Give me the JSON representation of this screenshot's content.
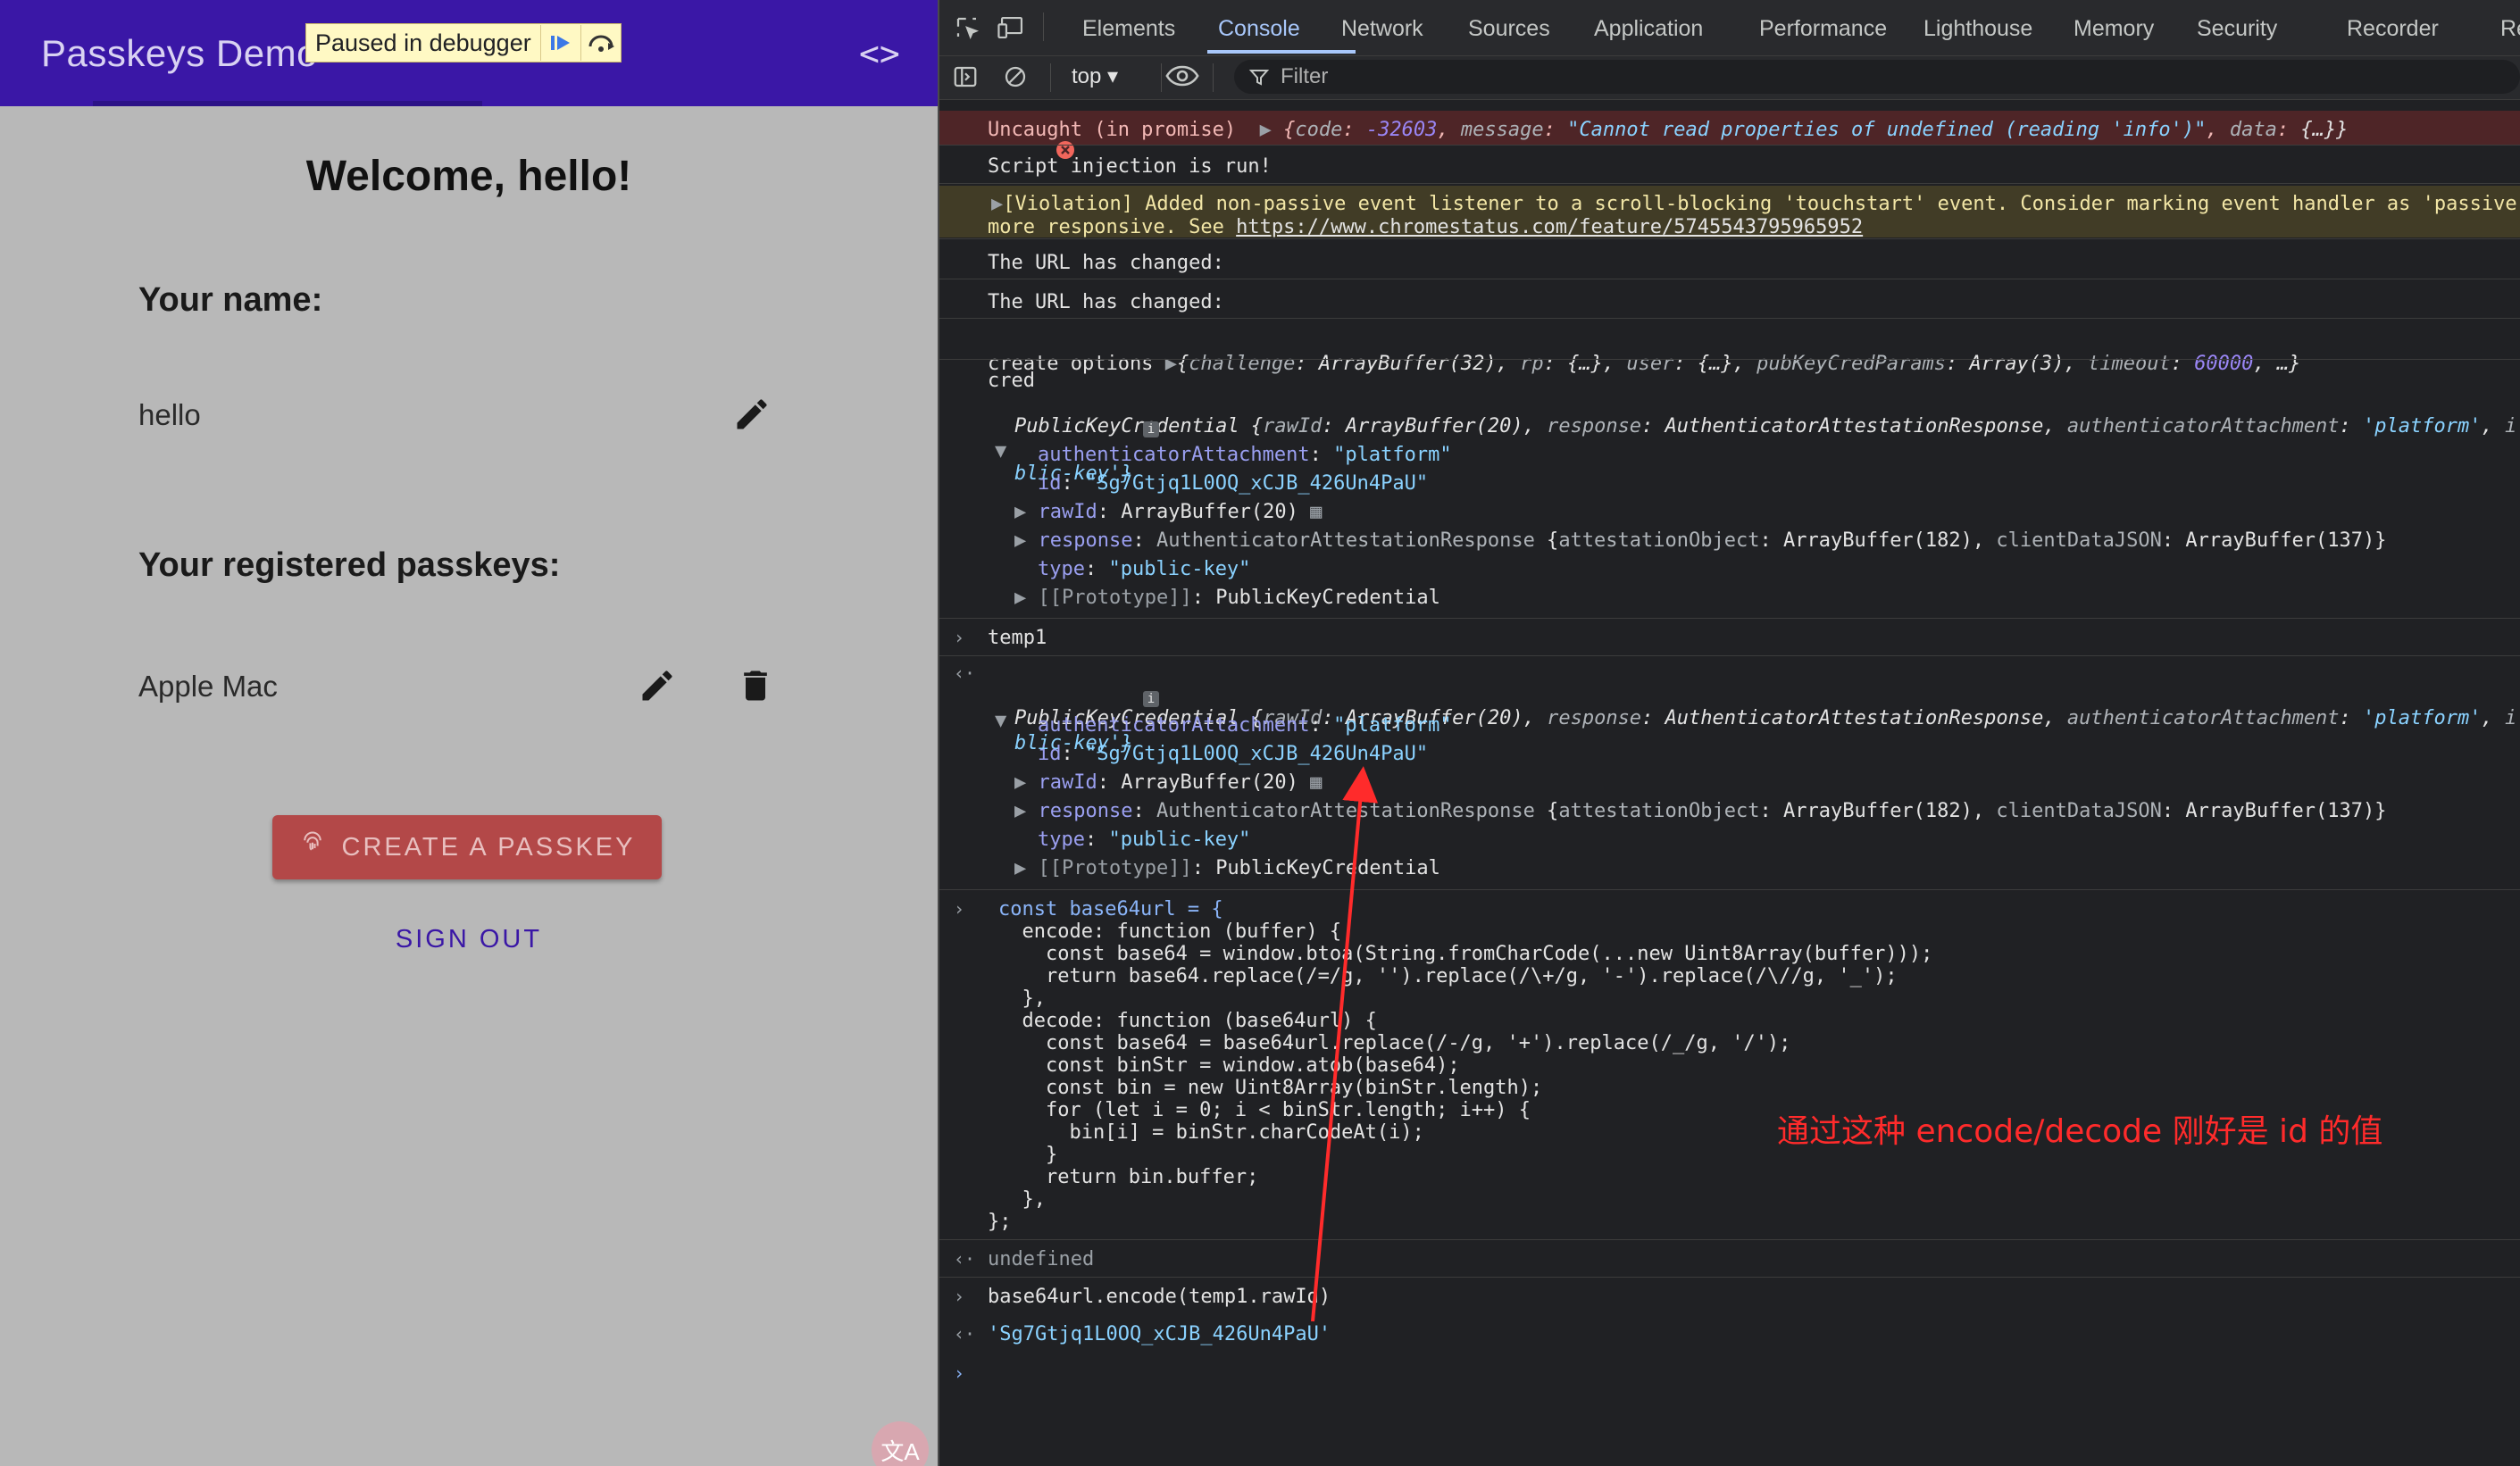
{
  "app": {
    "title": "Passkeys Demo",
    "code_toggle": "<>",
    "debugger_banner": "Paused in debugger",
    "welcome": "Welcome, hello!",
    "name_label": "Your name:",
    "name_value": "hello",
    "passkeys_label": "Your registered passkeys:",
    "passkeys": [
      {
        "name": "Apple Mac"
      }
    ],
    "create_button": "CREATE A PASSKEY",
    "sign_out": "SIGN OUT",
    "translate_badge": "文A",
    "brand_color": "#3a17a6"
  },
  "devtools": {
    "tabs": [
      "Elements",
      "Console",
      "Network",
      "Sources",
      "Application",
      "Performance",
      "Lighthouse",
      "Memory",
      "Security",
      "Recorder",
      "Re"
    ],
    "active_tab": "Console",
    "context": "top",
    "filter_placeholder": "Filter",
    "console": {
      "error": {
        "prefix": "Uncaught (in promise)",
        "code_key": "code",
        "code_val": "-32603",
        "message_key": "message",
        "message_val": "\"Cannot read properties of undefined (reading 'info')\"",
        "data_key": "data",
        "data_val": "{…}}"
      },
      "log_script": "Script injection is run!",
      "violation_line1": "[Violation] Added non-passive event listener to a scroll-blocking 'touchstart' event. Consider marking event handler as 'passive'",
      "violation_line2_prefix": "more responsive. See ",
      "violation_link": "https://www.chromestatus.com/feature/5745543795965952",
      "url_changed_1": "The URL has changed:",
      "url_changed_2": "The URL has changed:",
      "create_options_label": "create options",
      "create_options": {
        "k1": "challenge",
        "v1": "ArrayBuffer(32)",
        "k2": "rp",
        "v2": "{…}",
        "k3": "user",
        "v3": "{…}",
        "k4": "pubKeyCredParams",
        "v4": "Array(3)",
        "k5": "timeout",
        "v5": "60000",
        "tail": ", …}"
      },
      "cred_label": "cred",
      "pkc_summary": {
        "cls": "PublicKeyCredential",
        "k1": "rawId",
        "v1": "ArrayBuffer(20)",
        "k2": "response",
        "v2": "AuthenticatorAttestationResponse",
        "k3": "authenticatorAttachment",
        "v3": "'platform'",
        "k4": "i",
        "wrap": "blic-key'}"
      },
      "props": {
        "attach_key": "authenticatorAttachment",
        "attach_val": "\"platform\"",
        "id_key": "id",
        "id_val": "\"Sg7Gtjq1L0OQ_xCJB_426Un4PaU\"",
        "rawid_key": "rawId",
        "rawid_val": "ArrayBuffer(20)",
        "response_key": "response",
        "response_cls": "AuthenticatorAttestationResponse",
        "ao_key": "attestationObject",
        "ao_val": "ArrayBuffer(182)",
        "cdj_key": "clientDataJSON",
        "cdj_val": "ArrayBuffer(137)}",
        "type_key": "type",
        "type_val": "\"public-key\"",
        "proto_key": "[[Prototype]]",
        "proto_val": "PublicKeyCredential"
      },
      "temp1_input": "temp1",
      "code_lines": [
        "const base64url = {",
        "  encode: function (buffer) {",
        "    const base64 = window.btoa(String.fromCharCode(...new Uint8Array(buffer)));",
        "    return base64.replace(/=/g, '').replace(/\\+/g, '-').replace(/\\//g, '_');",
        "  },",
        "  decode: function (base64url) {",
        "    const base64 = base64url.replace(/-/g, '+').replace(/_/g, '/');",
        "    const binStr = window.atob(base64);",
        "    const bin = new Uint8Array(binStr.length);",
        "    for (let i = 0; i < binStr.length; i++) {",
        "      bin[i] = binStr.charCodeAt(i);",
        "    }",
        "    return bin.buffer;",
        "  },",
        "};"
      ],
      "undefined_result": "undefined",
      "encode_input": "base64url.encode(temp1.rawId)",
      "encode_result": "'Sg7Gtjq1L0OQ_xCJB_426Un4PaU'"
    }
  },
  "annotation": "通过这种 encode/decode 刚好是 id 的值",
  "annotation_color": "#ff2b2b"
}
